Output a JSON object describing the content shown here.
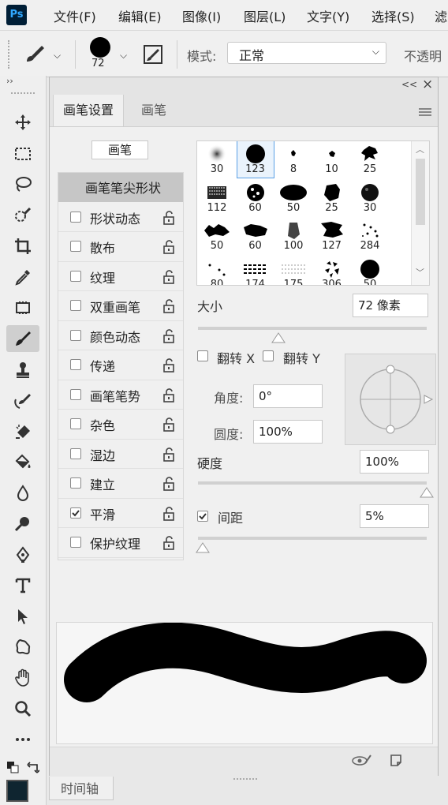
{
  "app": {
    "logo": "Ps"
  },
  "menu": [
    "文件(F)",
    "编辑(E)",
    "图像(I)",
    "图层(L)",
    "文字(Y)",
    "选择(S)",
    "滤"
  ],
  "options_bar": {
    "brush_size": "72",
    "mode_label": "模式:",
    "mode_value": "正常",
    "opacity_label": "不透明"
  },
  "panel": {
    "collapse_glyph": "<<",
    "close_glyph": "×",
    "tabs": [
      "画笔设置",
      "画笔"
    ],
    "active_tab": 0,
    "brush_button": "画笔",
    "brush_tip_shape": "画笔笔尖形状",
    "options": [
      {
        "label": "形状动态",
        "checked": false
      },
      {
        "label": "散布",
        "checked": false
      },
      {
        "label": "纹理",
        "checked": false
      },
      {
        "label": "双重画笔",
        "checked": false
      },
      {
        "label": "颜色动态",
        "checked": false
      },
      {
        "label": "传递",
        "checked": false
      },
      {
        "label": "画笔笔势",
        "checked": false
      },
      {
        "label": "杂色",
        "checked": false
      },
      {
        "label": "湿边",
        "checked": false
      },
      {
        "label": "建立",
        "checked": false
      },
      {
        "label": "平滑",
        "checked": true
      },
      {
        "label": "保护纹理",
        "checked": false
      }
    ],
    "presets": [
      "30",
      "123",
      "8",
      "10",
      "25",
      "112",
      "60",
      "50",
      "25",
      "30",
      "50",
      "60",
      "100",
      "127",
      "284",
      "80",
      "174",
      "175",
      "306",
      "50"
    ],
    "selected_preset": 1,
    "size_label": "大小",
    "size_value": "72 像素",
    "size_slider": 0.35,
    "flip_x": "翻转 X",
    "flip_y": "翻转 Y",
    "angle_label": "角度:",
    "angle_value": "0°",
    "roundness_label": "圆度:",
    "roundness_value": "100%",
    "hardness_label": "硬度",
    "hardness_value": "100%",
    "hardness_slider": 1.0,
    "spacing_label": "间距",
    "spacing_checked": true,
    "spacing_value": "5%",
    "spacing_slider": 0.02
  },
  "bottom_tab": "时间轴",
  "colors": {
    "accent": "#5aa0e6",
    "ps_blue": "#31a8ff",
    "ps_dark": "#001e36"
  }
}
